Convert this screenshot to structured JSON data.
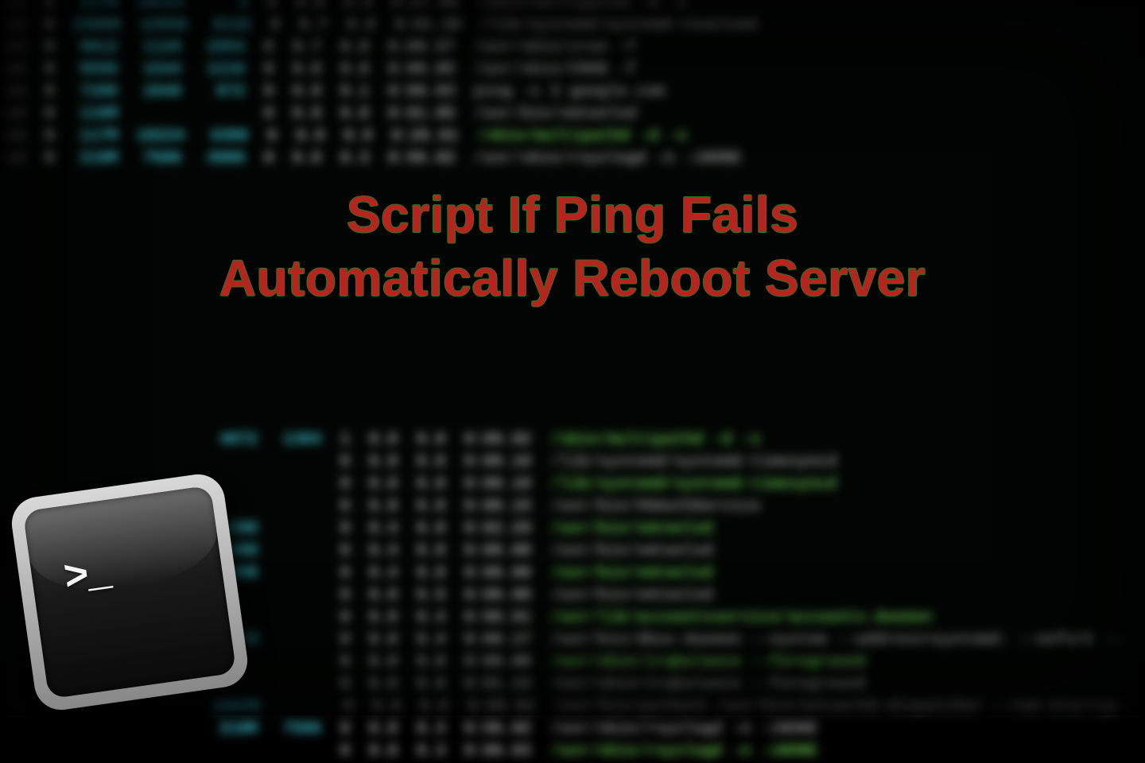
{
  "headline": {
    "line1": "Script If Ping Fails",
    "line2": "Automatically Reboot Server"
  },
  "terminal_icon": {
    "prompt": ">_"
  },
  "bg_rows_upper": [
    {
      "n": "0",
      "c": "117M",
      "a": "18224",
      "b": "4",
      "d": "0",
      "e": "0.8",
      "f": "0.8",
      "t": "0:27.08",
      "path": "/sbin/multipathd -d -s",
      "pc": "col-path"
    },
    {
      "n": "0",
      "c": "23000",
      "a": "12056",
      "b": "8132",
      "d": "0",
      "e": "0.7",
      "f": "0.8",
      "t": "0:01.29",
      "path": "/lib/systemd/systemd-resolved",
      "pc": "col-path"
    },
    {
      "n": "0",
      "c": "9812",
      "a": "1120",
      "b": "2054",
      "d": "0",
      "e": "0.7",
      "f": "0.8",
      "t": "0:00.57",
      "path": "/usr/sbin/cron -f",
      "pc": "col-path"
    },
    {
      "n": "0",
      "c": "9556",
      "a": "1544",
      "b": "1216",
      "d": "0",
      "e": "0.8",
      "f": "0.8",
      "t": "0:00.85",
      "path": "/usr/sbin/CRON -f",
      "pc": "col-path"
    },
    {
      "n": "0",
      "c": "7280",
      "a": "1840",
      "b": "872",
      "d": "0",
      "e": "0.8",
      "f": "0.1",
      "t": "0:00.03",
      "path": "ping -c 3 google.com",
      "pc": "col-path"
    },
    {
      "n": "0",
      "c": "116M",
      "a": "",
      "b": "",
      "d": "0",
      "e": "0.8",
      "f": "0.8",
      "t": "0:01.85",
      "path": "/usr/bin/vmtoolsd",
      "pc": "col-path"
    },
    {
      "n": "0",
      "c": "117M",
      "a": "18224",
      "b": "4300",
      "d": "0",
      "e": "0.8",
      "f": "0.9",
      "t": "0:26.01",
      "path": "/sbin/multipathd -d -s",
      "pc": "col-green"
    },
    {
      "n": "0",
      "c": "210M",
      "a": "7506",
      "b": "3980",
      "d": "0",
      "e": "0.8",
      "f": "0.3",
      "t": "0:56.02",
      "path": "/usr/sbin/rsyslogd -n -iNONE",
      "pc": "col-path"
    }
  ],
  "bg_rows_lower": [
    {
      "a": "4072",
      "b": "1304",
      "c": "1",
      "d": "0.8",
      "e": "0.8",
      "t": "0:00.02",
      "path": "/sbin/multipathd -d -s",
      "pc": "col-green"
    },
    {
      "a": "",
      "b": "",
      "c": "0",
      "d": "0.8",
      "e": "0.8",
      "t": "0:00.10",
      "path": "/lib/systemd/systemd-timesyncd",
      "pc": "col-path"
    },
    {
      "a": "",
      "b": "",
      "c": "0",
      "d": "0.8",
      "e": "0.8",
      "t": "0:00.10",
      "path": "/lib/systemd/systemd-timesyncd",
      "pc": "col-green"
    },
    {
      "a": "",
      "b": "",
      "c": "0",
      "d": "0.8",
      "e": "0.8",
      "t": "0:00.15",
      "path": "/usr/bin/VGAuthService",
      "pc": "col-path"
    },
    {
      "a": "1380",
      "b": "",
      "c": "8",
      "d": "0.4",
      "e": "0.8",
      "t": "0:02.29",
      "path": "/usr/bin/vmtoolsd",
      "pc": "col-green"
    },
    {
      "a": "1380",
      "b": "",
      "c": "0",
      "d": "0.4",
      "e": "0.8",
      "t": "0:00.00",
      "path": "/usr/bin/vmtoolsd",
      "pc": "col-path"
    },
    {
      "a": "1380",
      "b": "",
      "c": "0",
      "d": "0.4",
      "e": "0.8",
      "t": "0:00.00",
      "path": "/usr/bin/vmtoolsd",
      "pc": "col-green"
    },
    {
      "a": "",
      "b": "",
      "c": "0",
      "d": "0.8",
      "e": "0.5",
      "t": "0:00.00",
      "path": "/usr/bin/vmtoolsd",
      "pc": "col-path"
    },
    {
      "a": "",
      "b": "",
      "c": "0",
      "d": "0.8",
      "e": "0.4",
      "t": "0:00.01",
      "path": "/usr/lib/accountsservice/accounts-daemon",
      "pc": "col-green"
    },
    {
      "a": "4072",
      "b": "",
      "c": "0",
      "d": "0.8",
      "e": "0.4",
      "t": "0:00.17",
      "path": "/usr/bin/dbus-daemon --system --address=systemd: --nofork --",
      "pc": "col-path"
    },
    {
      "a": "",
      "b": "",
      "c": "0",
      "d": "0.8",
      "e": "0.8",
      "t": "0:00.00",
      "path": "/usr/sbin/irqbalance --foreground",
      "pc": "col-green"
    },
    {
      "a": "",
      "b": "",
      "c": "0",
      "d": "0.8",
      "e": "0.8",
      "t": "0:01.13",
      "path": "/usr/sbin/irqbalance --foreground",
      "pc": "col-path"
    },
    {
      "a": "20036",
      "b": "",
      "c": "0",
      "d": "0.8",
      "e": "0.6",
      "t": "0:00.62",
      "path": "/usr/bin/python3 /usr/bin/networkd-dispatcher --run-startup-",
      "pc": "col-path"
    },
    {
      "a": "210M",
      "b": "7506",
      "c": "0",
      "d": "0.8",
      "e": "0.3",
      "t": "0:56.02",
      "path": "/usr/sbin/rsyslogd -n -iNONE",
      "pc": "col-path"
    },
    {
      "a": "",
      "b": "",
      "c": "0",
      "d": "0.8",
      "e": "0.3",
      "t": "0:00.03",
      "path": "/usr/sbin/rsyslogd -n -iNONE",
      "pc": "col-green"
    }
  ]
}
